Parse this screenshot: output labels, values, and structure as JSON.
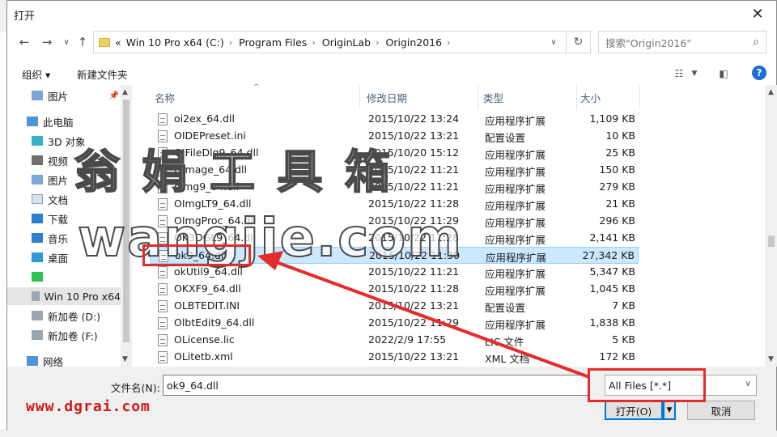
{
  "title": "打开",
  "address": {
    "overflow": "«",
    "crumbs": [
      "Win 10 Pro x64 (C:)",
      "Program Files",
      "OriginLab",
      "Origin2016"
    ]
  },
  "search": {
    "placeholder": "搜索\"Origin2016\""
  },
  "toolbar": {
    "organize": "组织 ▾",
    "new_folder": "新建文件夹"
  },
  "nav": {
    "items": [
      {
        "label": "图片",
        "pinned": true
      },
      {
        "label": "此电脑"
      },
      {
        "label": "3D 对象"
      },
      {
        "label": "视频"
      },
      {
        "label": "图片"
      },
      {
        "label": "文档"
      },
      {
        "label": "下载"
      },
      {
        "label": "音乐"
      },
      {
        "label": "桌面"
      },
      {
        "label": ""
      },
      {
        "label": "Win 10 Pro x64"
      },
      {
        "label": "新加卷 (D:)"
      },
      {
        "label": "新加卷 (F:)"
      },
      {
        "label": "网络"
      }
    ]
  },
  "columns": {
    "name": "名称",
    "date": "修改日期",
    "type": "类型",
    "size": "大小"
  },
  "files": [
    {
      "name": "oi2ex_64.dll",
      "date": "2015/10/22 13:24",
      "type": "应用程序扩展",
      "size": "1,109 KB"
    },
    {
      "name": "OIDEPreset.ini",
      "date": "2015/10/22 13:21",
      "type": "配置设置",
      "size": "10 KB"
    },
    {
      "name": "OIFileDlg9_64.dll",
      "date": "2015/10/20 15:12",
      "type": "应用程序扩展",
      "size": "25 KB"
    },
    {
      "name": "OImage_64.dll",
      "date": "2015/10/22 11:21",
      "type": "应用程序扩展",
      "size": "150 KB"
    },
    {
      "name": "oimg9_64.dll",
      "date": "2015/10/22 11:21",
      "type": "应用程序扩展",
      "size": "279 KB"
    },
    {
      "name": "OImgLT9_64.dll",
      "date": "2015/10/22 11:28",
      "type": "应用程序扩展",
      "size": "21 KB"
    },
    {
      "name": "OImgProc_64.dll",
      "date": "2015/10/22 11:29",
      "type": "应用程序扩展",
      "size": "296 KB"
    },
    {
      "name": "OK3DGL9_64.dll",
      "date": "2015/10/22 11:28",
      "type": "应用程序扩展",
      "size": "2,141 KB"
    },
    {
      "name": "ok9_64.dll",
      "date": "2015/10/22 11:30",
      "type": "应用程序扩展",
      "size": "27,342 KB",
      "selected": true
    },
    {
      "name": "okUtil9_64.dll",
      "date": "2015/10/22 11:21",
      "type": "应用程序扩展",
      "size": "5,347 KB"
    },
    {
      "name": "OKXF9_64.dll",
      "date": "2015/10/22 11:28",
      "type": "应用程序扩展",
      "size": "1,045 KB"
    },
    {
      "name": "OLBTEDIT.INI",
      "date": "2015/10/22 13:21",
      "type": "配置设置",
      "size": "7 KB"
    },
    {
      "name": "OlbtEdit9_64.dll",
      "date": "2015/10/22 11:29",
      "type": "应用程序扩展",
      "size": "1,838 KB"
    },
    {
      "name": "OLicense.lic",
      "date": "2022/2/9 17:55",
      "type": "LIC 文件",
      "size": "5 KB"
    },
    {
      "name": "OLitetb.xml",
      "date": "2015/10/22 13:21",
      "type": "XML 文档",
      "size": "172 KB"
    }
  ],
  "filename": {
    "label": "文件名(N):",
    "value": "ok9_64.dll"
  },
  "filetype": {
    "value": "All Files [*.*]"
  },
  "buttons": {
    "open": "打开(O)",
    "cancel": "取消"
  },
  "watermark": {
    "top": "翁 娟 工 具 箱",
    "bottom": "wangjie.com"
  },
  "site_url": "www.dgrai.com",
  "colors": {
    "selection": "#cce8ff",
    "accent": "#0078d7",
    "annotation": "#e52b2b"
  }
}
